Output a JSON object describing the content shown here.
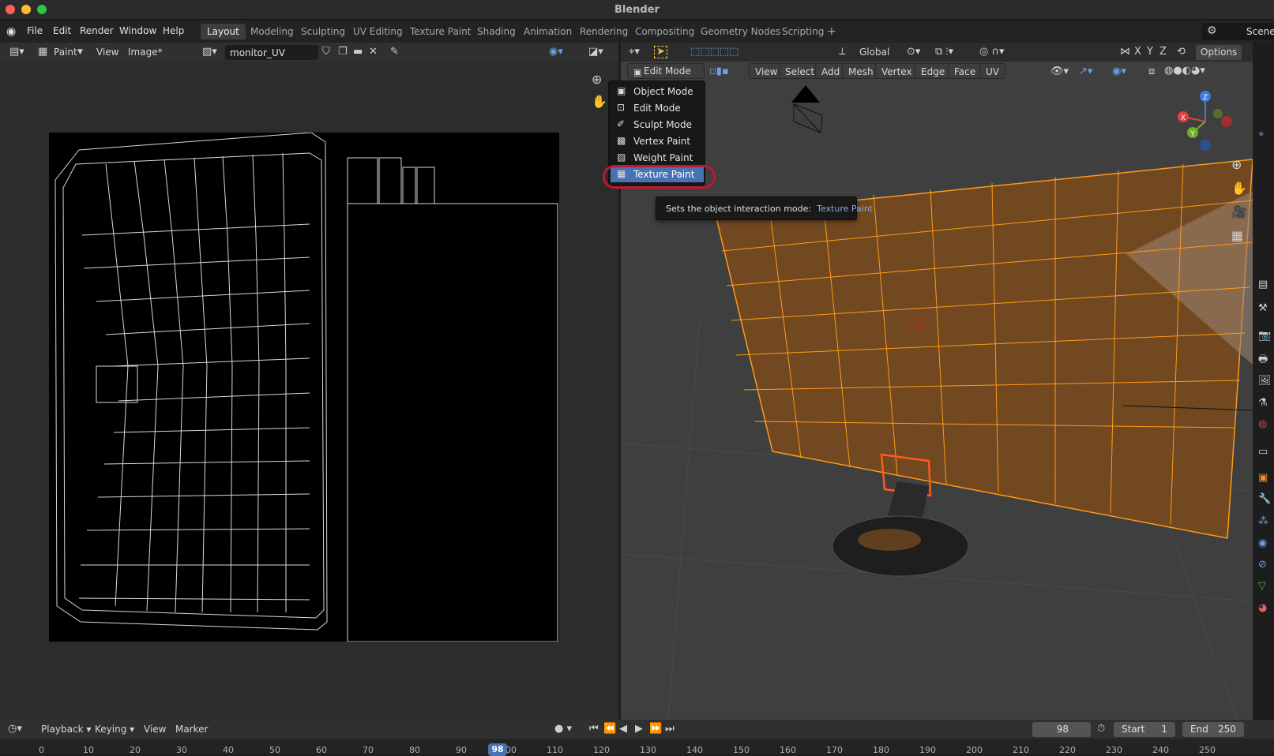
{
  "window": {
    "title": "Blender"
  },
  "menu": [
    "File",
    "Edit",
    "Render",
    "Window",
    "Help"
  ],
  "workspaces": [
    "Layout",
    "Modeling",
    "Sculpting",
    "UV Editing",
    "Texture Paint",
    "Shading",
    "Animation",
    "Rendering",
    "Compositing",
    "Geometry Nodes",
    "Scripting"
  ],
  "active_workspace": "Layout",
  "scene": {
    "label": "Scene"
  },
  "image_editor": {
    "mode": "Paint",
    "view": "View",
    "image_menu": "Image*",
    "image_name": "monitor_UV"
  },
  "viewport": {
    "mode": "Edit Mode",
    "menus": [
      "View",
      "Select",
      "Add",
      "Mesh",
      "Vertex",
      "Edge",
      "Face",
      "UV"
    ],
    "orientation": "Global",
    "options": "Options",
    "axis_labels": {
      "x": "X",
      "y": "Y",
      "z": "Z"
    }
  },
  "mode_dropdown": {
    "items": [
      "Object Mode",
      "Edit Mode",
      "Sculpt Mode",
      "Vertex Paint",
      "Weight Paint",
      "Texture Paint"
    ],
    "selected": "Texture Paint"
  },
  "tooltip": {
    "text": "Sets the object interaction mode:",
    "highlight": "Texture Paint"
  },
  "timeline": {
    "menus": [
      "Playback",
      "Keying",
      "View",
      "Marker"
    ],
    "current_frame": "98",
    "start_label": "Start",
    "start": "1",
    "end_label": "End",
    "end": "250",
    "ticks": [
      "0",
      "10",
      "20",
      "30",
      "40",
      "50",
      "60",
      "70",
      "80",
      "90",
      "100",
      "110",
      "120",
      "130",
      "140",
      "150",
      "160",
      "170",
      "180",
      "190",
      "200",
      "210",
      "220",
      "230",
      "240",
      "250"
    ]
  },
  "colors": {
    "accent": "#4772b3",
    "highlight_ring": "#c0182f",
    "mesh_edge": "#ff9a1a",
    "mesh_fill": "#7a4a1a"
  }
}
